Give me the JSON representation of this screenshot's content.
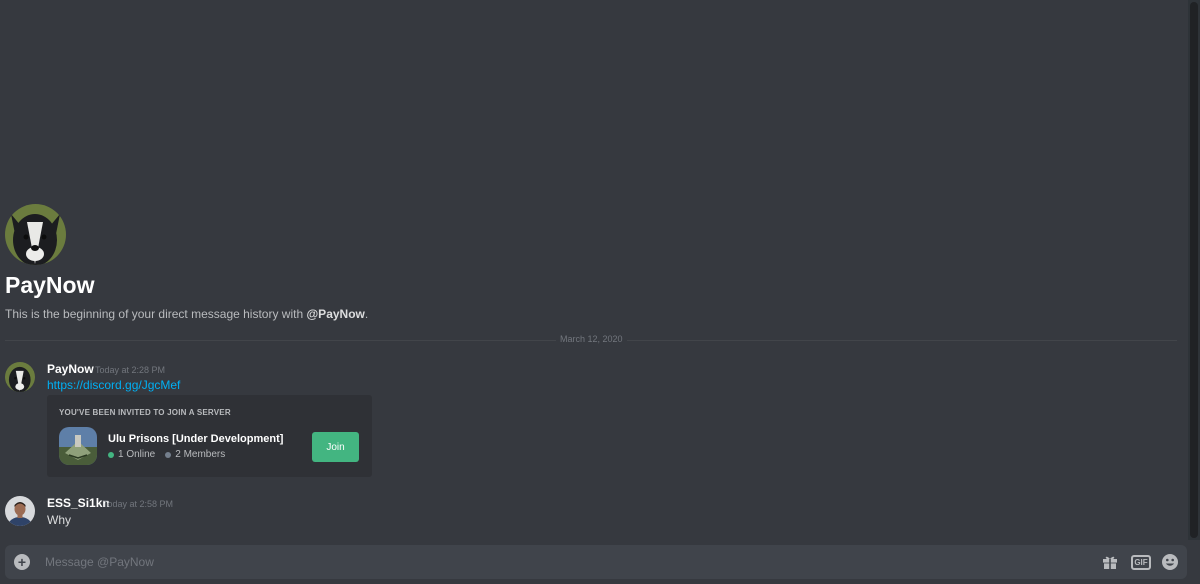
{
  "intro": {
    "title": "PayNow",
    "desc_prefix": "This is the beginning of your direct message history with ",
    "desc_mention": "@PayNow",
    "desc_suffix": "."
  },
  "divider": {
    "date": "March 12, 2020"
  },
  "messages": [
    {
      "author": "PayNow",
      "time": "Today at 2:28 PM",
      "link": "https://discord.gg/JgcMef",
      "invite": {
        "header": "YOU'VE BEEN INVITED TO JOIN A SERVER",
        "server_name": "Ulu Prisons [Under Development]",
        "online": "1 Online",
        "members": "2 Members",
        "join_label": "Join"
      }
    },
    {
      "author": "ESS_Si1kn",
      "time": "Today at 2:58 PM",
      "text": "Why"
    }
  ],
  "composer": {
    "placeholder": "Message @PayNow",
    "gif_label": "GIF"
  },
  "colors": {
    "background": "#36393f",
    "online": "#43b581",
    "link": "#00b0f4",
    "join": "#43b581"
  },
  "icons": [
    "add-attachment-icon",
    "gift-icon",
    "gif-icon",
    "emoji-icon"
  ]
}
